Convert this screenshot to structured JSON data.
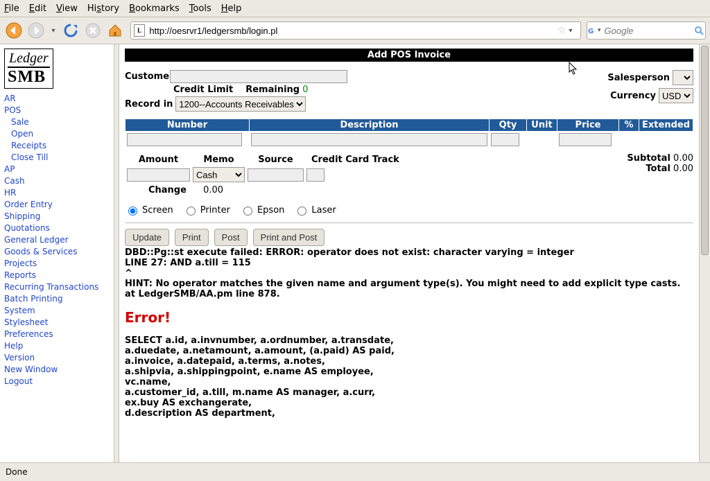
{
  "browser": {
    "menu": {
      "file": "File",
      "edit": "Edit",
      "view": "View",
      "history": "History",
      "bookmarks": "Bookmarks",
      "tools": "Tools",
      "help": "Help"
    },
    "url": "http://oesrvr1/ledgersmb/login.pl",
    "search_placeholder": "Google",
    "status": "Done"
  },
  "sidebar": {
    "logo_line1": "Ledger",
    "logo_line2": "SMB",
    "items": [
      {
        "label": "AR",
        "sub": false
      },
      {
        "label": "POS",
        "sub": false
      },
      {
        "label": "Sale",
        "sub": true
      },
      {
        "label": "Open",
        "sub": true
      },
      {
        "label": "Receipts",
        "sub": true
      },
      {
        "label": "Close Till",
        "sub": true
      },
      {
        "label": "AP",
        "sub": false
      },
      {
        "label": "Cash",
        "sub": false
      },
      {
        "label": "HR",
        "sub": false
      },
      {
        "label": "Order Entry",
        "sub": false
      },
      {
        "label": "Shipping",
        "sub": false
      },
      {
        "label": "Quotations",
        "sub": false
      },
      {
        "label": "General Ledger",
        "sub": false
      },
      {
        "label": "Goods & Services",
        "sub": false
      },
      {
        "label": "Projects",
        "sub": false
      },
      {
        "label": "Reports",
        "sub": false
      },
      {
        "label": "Recurring Transactions",
        "sub": false
      },
      {
        "label": "Batch Printing",
        "sub": false
      },
      {
        "label": "System",
        "sub": false
      },
      {
        "label": "Stylesheet",
        "sub": false
      },
      {
        "label": "Preferences",
        "sub": false
      },
      {
        "label": "Help",
        "sub": false
      },
      {
        "label": "Version",
        "sub": false
      },
      {
        "label": "New Window",
        "sub": false
      },
      {
        "label": "Logout",
        "sub": false
      }
    ]
  },
  "page": {
    "title": "Add POS Invoice",
    "labels": {
      "customer": "Customer",
      "credit_limit": "Credit Limit",
      "remaining": "Remaining",
      "remaining_value": "0",
      "record_in": "Record in",
      "record_in_value": "1200--Accounts Receivables",
      "salesperson": "Salesperson",
      "currency": "Currency",
      "currency_value": "USD"
    },
    "cols": {
      "number": "Number",
      "description": "Description",
      "qty": "Qty",
      "unit": "Unit",
      "price": "Price",
      "pct": "%",
      "extended": "Extended"
    },
    "pay": {
      "amount": "Amount",
      "memo": "Memo",
      "memo_value": "Cash",
      "source": "Source",
      "cctrack": "Credit Card Track",
      "change": "Change",
      "change_value": "0.00",
      "subtotal_label": "Subtotal",
      "subtotal_value": "0.00",
      "total_label": "Total",
      "total_value": "0.00"
    },
    "outputs": {
      "screen": "Screen",
      "printer": "Printer",
      "epson": "Epson",
      "laser": "Laser"
    },
    "buttons": {
      "update": "Update",
      "print": "Print",
      "post": "Post",
      "printpost": "Print and Post"
    },
    "error": {
      "msg1": "DBD::Pg::st execute failed: ERROR: operator does not exist: character varying = integer",
      "msg2": "LINE 27: AND a.till = 115",
      "msg3": "^",
      "msg4": "HINT: No operator matches the given name and argument type(s). You might need to add explicit type casts. at LedgerSMB/AA.pm line 878.",
      "heading": "Error!",
      "sql": [
        "SELECT a.id, a.invnumber, a.ordnumber, a.transdate,",
        "a.duedate, a.netamount, a.amount, (a.paid) AS paid,",
        "a.invoice, a.datepaid, a.terms, a.notes,",
        "a.shipvia, a.shippingpoint, e.name AS employee,",
        "vc.name,",
        "a.customer_id, a.till, m.name AS manager, a.curr,",
        "ex.buy AS exchangerate,",
        "d.description AS department,"
      ]
    }
  }
}
